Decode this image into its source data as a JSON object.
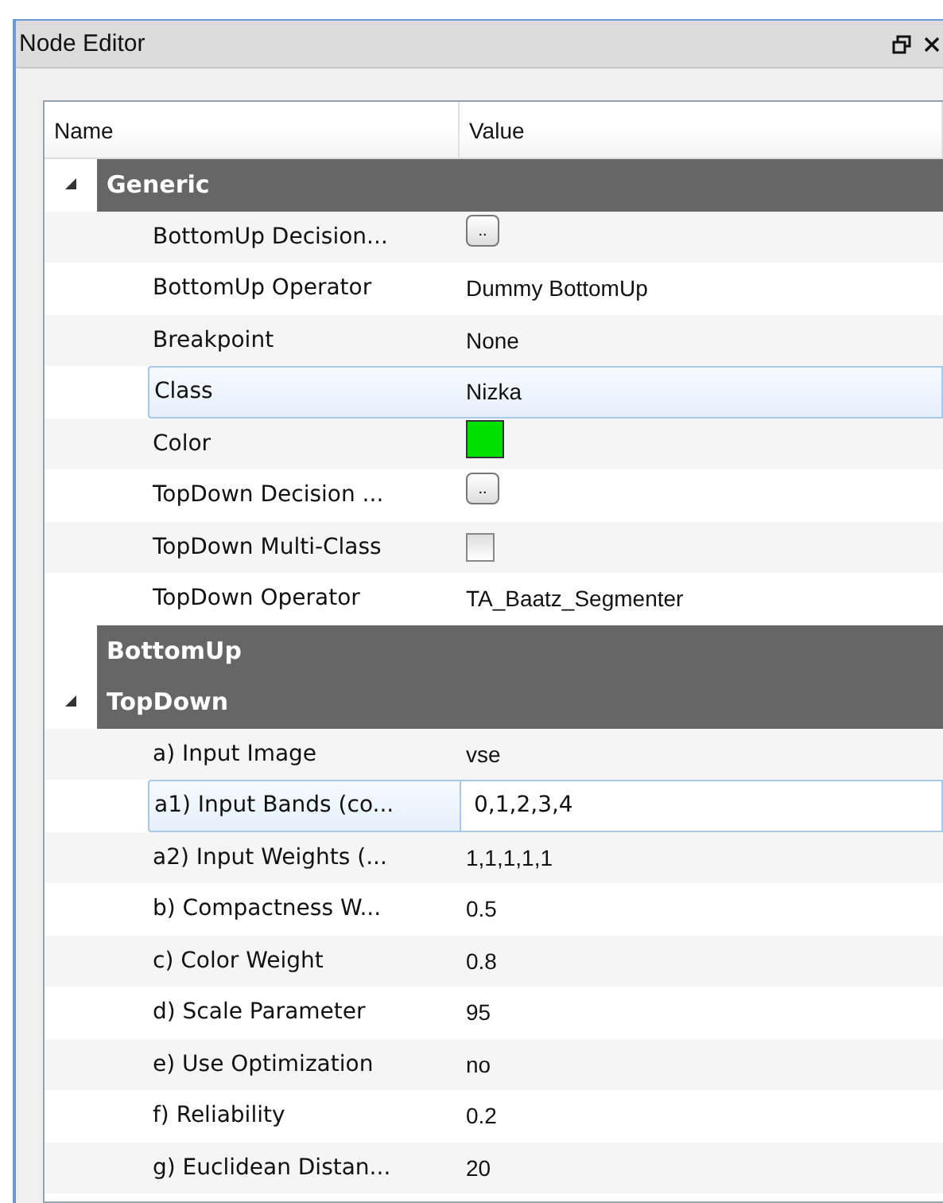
{
  "window": {
    "title": "Node Editor"
  },
  "columns": [
    "Name",
    "Value"
  ],
  "groups": [
    {
      "name": "Generic",
      "expanded": true,
      "rows": [
        {
          "name": "BottomUp Decision...",
          "kind": "button",
          "value": "..",
          "selected": false
        },
        {
          "name": "BottomUp Operator",
          "kind": "text",
          "value": "Dummy BottomUp",
          "selected": false
        },
        {
          "name": "Breakpoint",
          "kind": "text",
          "value": "None",
          "selected": false
        },
        {
          "name": "Class",
          "kind": "text",
          "value": "Nizka",
          "selected": true
        },
        {
          "name": "Color",
          "kind": "color",
          "color": "#00e000",
          "selected": false
        },
        {
          "name": "TopDown Decision ...",
          "kind": "button",
          "value": "..",
          "selected": false
        },
        {
          "name": "TopDown Multi-Class",
          "kind": "checkbox",
          "checked": false,
          "selected": false
        },
        {
          "name": "TopDown Operator",
          "kind": "text",
          "value": "TA_Baatz_Segmenter",
          "selected": false
        }
      ]
    },
    {
      "name": "BottomUp",
      "expanded": false
    },
    {
      "name": "TopDown",
      "expanded": true,
      "rows": [
        {
          "name": "a) Input Image",
          "kind": "text",
          "value": "vse",
          "selected": false
        },
        {
          "name": "a1) Input Bands (co...",
          "kind": "input",
          "value": "0,1,2,3,4",
          "selected": true
        },
        {
          "name": "a2) Input Weights (...",
          "kind": "text",
          "value": "1,1,1,1,1",
          "selected": false
        },
        {
          "name": "b) Compactness W...",
          "kind": "text",
          "value": "0.5",
          "selected": false
        },
        {
          "name": "c) Color Weight",
          "kind": "text",
          "value": "0.8",
          "selected": false
        },
        {
          "name": "d) Scale Parameter",
          "kind": "text",
          "value": "95",
          "selected": false
        },
        {
          "name": "e) Use Optimization",
          "kind": "text",
          "value": "no",
          "selected": false
        },
        {
          "name": "f) Reliability",
          "kind": "text",
          "value": "0.2",
          "selected": false
        },
        {
          "name": "g) Euclidean Distan...",
          "kind": "text",
          "value": "20",
          "selected": false
        }
      ]
    }
  ]
}
